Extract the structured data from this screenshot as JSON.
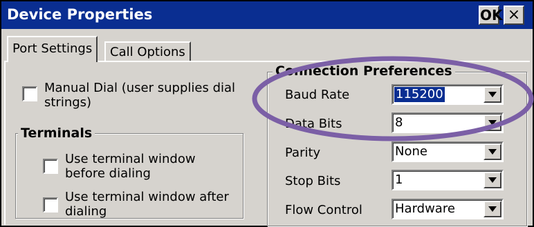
{
  "window": {
    "title": "Device Properties",
    "ok_label": "OK",
    "close_label": "×"
  },
  "tabs": [
    {
      "label": "Port Settings"
    },
    {
      "label": "Call Options"
    }
  ],
  "manual_dial": {
    "label_line1": "Manual Dial (user supplies dial",
    "label_line2": "strings)",
    "checked": false
  },
  "terminals": {
    "title": "Terminals",
    "before": {
      "line1": "Use terminal window",
      "line2": "before dialing",
      "checked": false
    },
    "after": {
      "line1": "Use terminal window after",
      "line2": "dialing",
      "checked": false
    }
  },
  "connection": {
    "title": "Connection Preferences",
    "fields": [
      {
        "label": "Baud Rate",
        "value": "115200"
      },
      {
        "label": "Data Bits",
        "value": "8"
      },
      {
        "label": "Parity",
        "value": "None"
      },
      {
        "label": "Stop Bits",
        "value": "1"
      },
      {
        "label": "Flow Control",
        "value": "Hardware"
      }
    ]
  },
  "highlight_color": "#7b5fa6"
}
